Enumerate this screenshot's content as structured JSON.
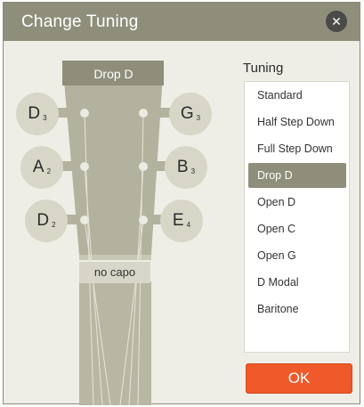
{
  "dialog": {
    "title": "Change Tuning",
    "close_icon": "close-icon"
  },
  "headstock": {
    "preset_label": "Drop D",
    "capo_label": "no capo",
    "tuners": [
      {
        "note": "D",
        "octave": "3"
      },
      {
        "note": "A",
        "octave": "2"
      },
      {
        "note": "D",
        "octave": "2"
      },
      {
        "note": "G",
        "octave": "3"
      },
      {
        "note": "B",
        "octave": "3"
      },
      {
        "note": "E",
        "octave": "4"
      }
    ]
  },
  "tuning_panel": {
    "heading": "Tuning",
    "selected": "Drop D",
    "options": [
      "Standard",
      "Half Step Down",
      "Full Step Down",
      "Drop D",
      "Open D",
      "Open C",
      "Open G",
      "D Modal",
      "Baritone"
    ]
  },
  "ok_button": {
    "label": "OK"
  },
  "colors": {
    "titlebar": "#8f8e7a",
    "background": "#efeee6",
    "headstock": "#b3b29e",
    "tuner": "#d7d6c7",
    "selected": "#8f8e7a",
    "ok": "#f05a2a"
  }
}
